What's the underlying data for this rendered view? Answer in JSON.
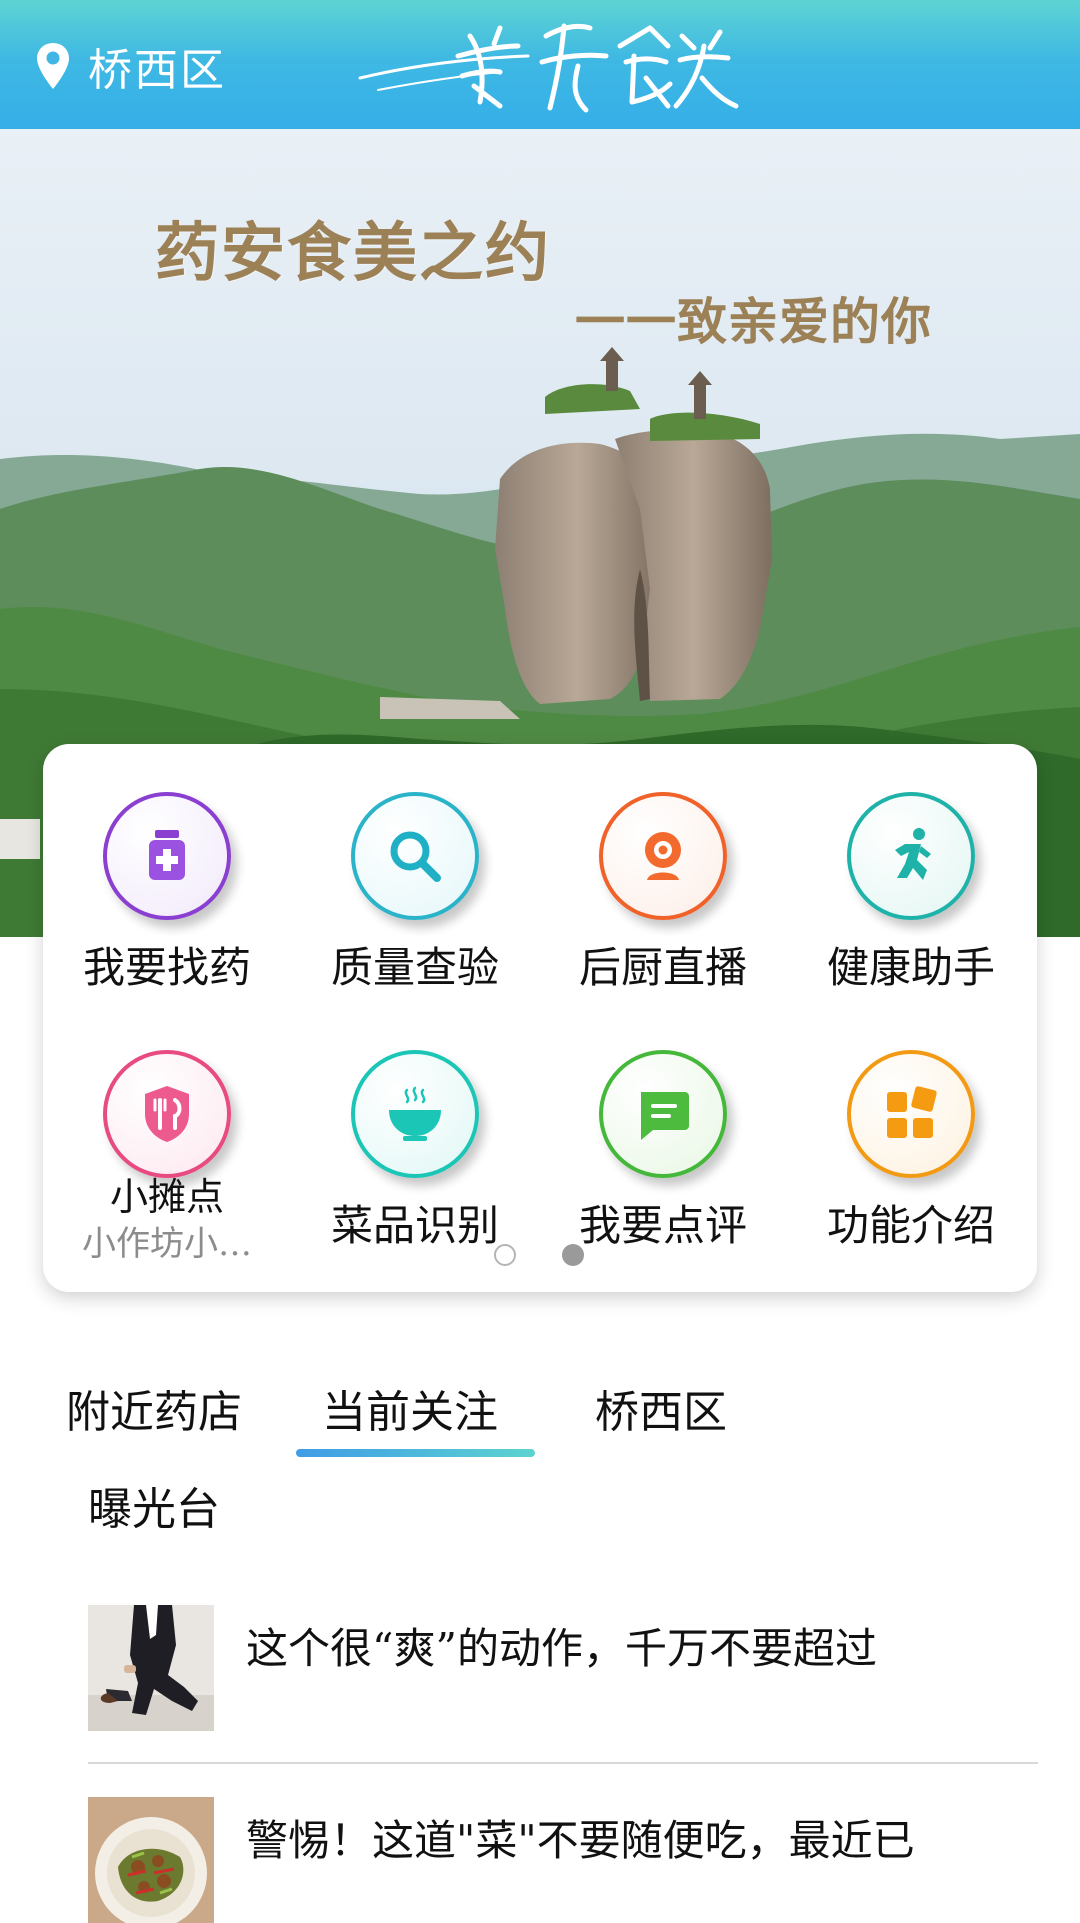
{
  "header": {
    "location_label": "桥西区",
    "location_icon": "map-pin-icon",
    "brand_logo_text": "药安食美",
    "background_gradient": [
      "#5ed3d3",
      "#35aee8"
    ]
  },
  "banner": {
    "title": "药安食美之约",
    "subtitle": "一一致亲爱的你",
    "text_color": "#9c8157"
  },
  "grid": {
    "items": [
      {
        "label": "我要找药",
        "icon": "medicine-bottle-icon",
        "color": "#8a3fd1"
      },
      {
        "label": "质量查验",
        "icon": "search-icon",
        "color": "#2bb3c9"
      },
      {
        "label": "后厨直播",
        "icon": "webcam-icon",
        "color": "#f0622a"
      },
      {
        "label": "健康助手",
        "icon": "running-person-icon",
        "color": "#1fb2a8"
      },
      {
        "label": "小摊点",
        "sublabel": "小作坊小…",
        "icon": "shield-cutlery-icon",
        "color": "#e84a82"
      },
      {
        "label": "菜品识别",
        "icon": "steaming-bowl-icon",
        "color": "#1cc6b6"
      },
      {
        "label": "我要点评",
        "icon": "comment-icon",
        "color": "#45b83c"
      },
      {
        "label": "功能介绍",
        "icon": "grid-blocks-icon",
        "color": "#f29a14"
      }
    ],
    "page_count": 2
  },
  "tabs": {
    "items": [
      "附近药店",
      "当前关注",
      "桥西区",
      "曝光台"
    ],
    "active": "当前关注",
    "accent_gradient": [
      "#3f9ce6",
      "#5cd4d0"
    ]
  },
  "news": {
    "items": [
      {
        "title": "这个很“爽”的动作，千万不要超过",
        "thumb": "man-in-suit-thumbnail"
      },
      {
        "title": "警惕！这道\"菜\"不要随便吃，最近已",
        "thumb": "vegetable-dish-thumbnail"
      }
    ]
  }
}
